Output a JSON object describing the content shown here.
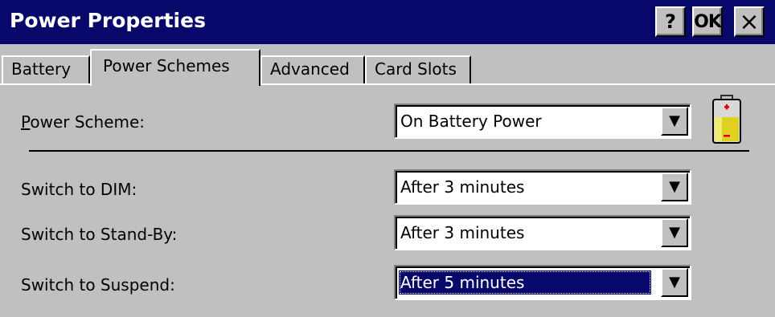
{
  "window": {
    "title": "Power Properties",
    "buttons": {
      "help": "?",
      "ok": "OK",
      "close": "×"
    }
  },
  "tabs": [
    {
      "label": "Battery",
      "active": false
    },
    {
      "label": "Power Schemes",
      "active": true
    },
    {
      "label": "Advanced",
      "active": false
    },
    {
      "label": "Card Slots",
      "active": false
    }
  ],
  "power_scheme": {
    "label": "Power Scheme:",
    "value": "On Battery Power"
  },
  "settings": [
    {
      "label": "Switch to DIM:",
      "value": "After 3 minutes",
      "selected": false
    },
    {
      "label": "Switch to Stand-By:",
      "value": "After 3 minutes",
      "selected": false
    },
    {
      "label": "Switch to Suspend:",
      "value": "After 5 minutes",
      "selected": true
    }
  ],
  "icons": {
    "battery": "battery-icon",
    "dropdown": "chevron-down-icon"
  },
  "colors": {
    "titlebar": "#08086b",
    "face": "#c0c0c0",
    "selection": "#08086b"
  }
}
